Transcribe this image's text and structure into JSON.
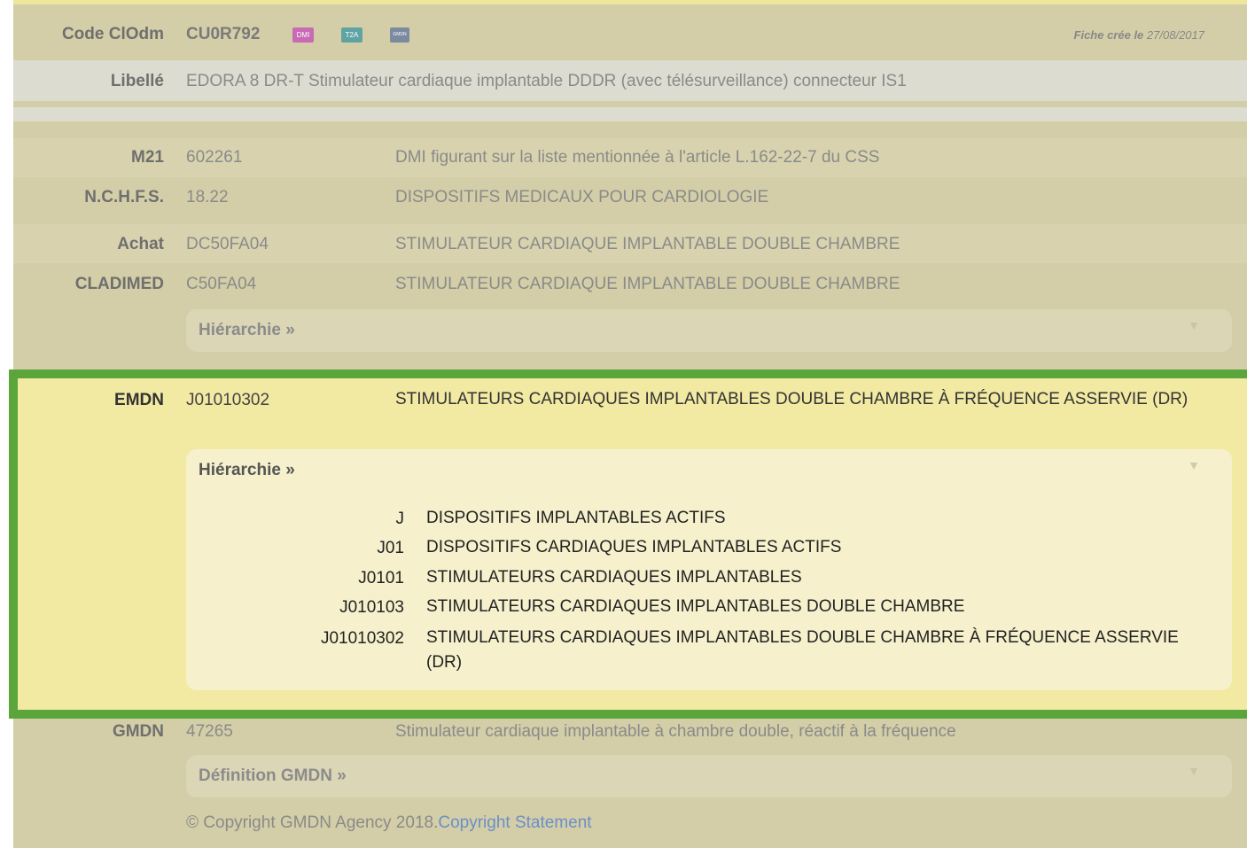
{
  "header": {
    "code_label": "Code ClOdm",
    "code_value": "CU0R792",
    "badges": [
      {
        "text": "DMI",
        "color": "#c86ab4"
      },
      {
        "text": "T2A",
        "color": "#5fa3a3"
      },
      {
        "text": "GMDN",
        "color": "#7b8aa0"
      }
    ],
    "created_prefix": "Fiche crée le",
    "created_date": "27/08/2017"
  },
  "libelle": {
    "label": "Libellé",
    "value": "EDORA 8 DR-T Stimulateur cardiaque implantable DDDR (avec télésurveillance) connecteur IS1"
  },
  "classifications": [
    {
      "label": "M21",
      "code": "602261",
      "desc": "DMI figurant sur la liste mentionnée à l'article L.162-22-7 du CSS"
    },
    {
      "label": "N.C.H.F.S.",
      "code": "18.22",
      "desc": "DISPOSITIFS MEDICAUX POUR CARDIOLOGIE"
    },
    {
      "label": "Achat",
      "code": "DC50FA04",
      "desc": "STIMULATEUR CARDIAQUE IMPLANTABLE DOUBLE CHAMBRE"
    },
    {
      "label": "CLADIMED",
      "code": "C50FA04",
      "desc": "STIMULATEUR CARDIAQUE IMPLANTABLE DOUBLE CHAMBRE"
    }
  ],
  "cladimed_hierarchy_label": "Hiérarchie »",
  "emdn": {
    "label": "EMDN",
    "code": "J01010302",
    "desc": "STIMULATEURS CARDIAQUES IMPLANTABLES DOUBLE CHAMBRE À FRÉQUENCE ASSERVIE (DR)",
    "hierarchy_label": "Hiérarchie »",
    "hierarchy": [
      {
        "code": "J",
        "text": "DISPOSITIFS IMPLANTABLES ACTIFS"
      },
      {
        "code": "J01",
        "text": "DISPOSITIFS CARDIAQUES IMPLANTABLES ACTIFS"
      },
      {
        "code": "J0101",
        "text": "STIMULATEURS CARDIAQUES IMPLANTABLES"
      },
      {
        "code": "J010103",
        "text": "STIMULATEURS CARDIAQUES IMPLANTABLES DOUBLE CHAMBRE"
      },
      {
        "code": "J01010302",
        "text": "STIMULATEURS CARDIAQUES IMPLANTABLES DOUBLE CHAMBRE À FRÉQUENCE ASSERVIE (DR)"
      }
    ]
  },
  "gmdn": {
    "label": "GMDN",
    "code": "47265",
    "desc": "Stimulateur cardiaque implantable à chambre double, réactif à la fréquence",
    "definition_label": "Définition GMDN »",
    "copyright_text": "© Copyright GMDN Agency 2018.",
    "copyright_link": "Copyright Statement"
  },
  "colors": {
    "highlight_border": "#5aa63a",
    "highlight_bg": "#f2e9a3",
    "link": "#6b8fc8"
  }
}
